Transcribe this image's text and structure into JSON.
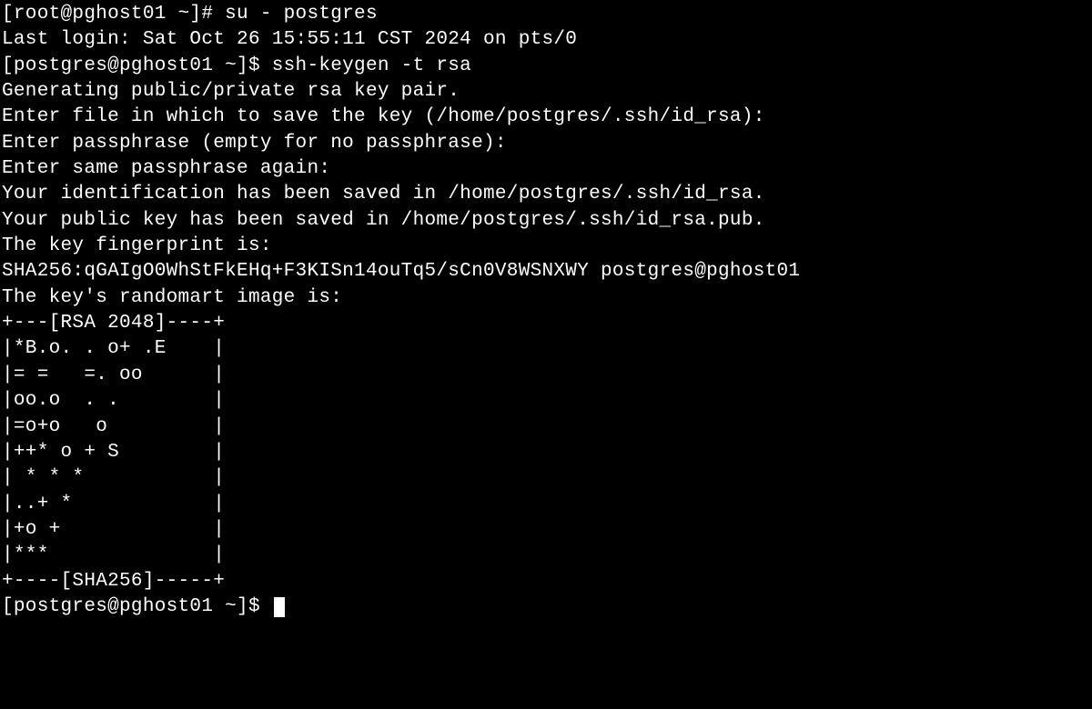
{
  "lines": {
    "l0": "[root@pghost01 ~]# su - postgres",
    "l1": "Last login: Sat Oct 26 15:55:11 CST 2024 on pts/0",
    "l2": "[postgres@pghost01 ~]$ ssh-keygen -t rsa",
    "l3": "Generating public/private rsa key pair.",
    "l4": "Enter file in which to save the key (/home/postgres/.ssh/id_rsa):",
    "l5": "Enter passphrase (empty for no passphrase):",
    "l6": "Enter same passphrase again:",
    "l7": "Your identification has been saved in /home/postgres/.ssh/id_rsa.",
    "l8": "Your public key has been saved in /home/postgres/.ssh/id_rsa.pub.",
    "l9": "The key fingerprint is:",
    "l10": "SHA256:qGAIgO0WhStFkEHq+F3KISn14ouTq5/sCn0V8WSNXWY postgres@pghost01",
    "l11": "The key's randomart image is:",
    "l12": "+---[RSA 2048]----+",
    "l13": "|*B.o. . o+ .E    |",
    "l14": "|= =   =. oo      |",
    "l15": "|oo.o  . .        |",
    "l16": "|=o+o   o         |",
    "l17": "|++* o + S        |",
    "l18": "| * * *           |",
    "l19": "|..+ *            |",
    "l20": "|+o +             |",
    "l21": "|***              |",
    "l22": "+----[SHA256]-----+",
    "l23": "[postgres@pghost01 ~]$ "
  }
}
